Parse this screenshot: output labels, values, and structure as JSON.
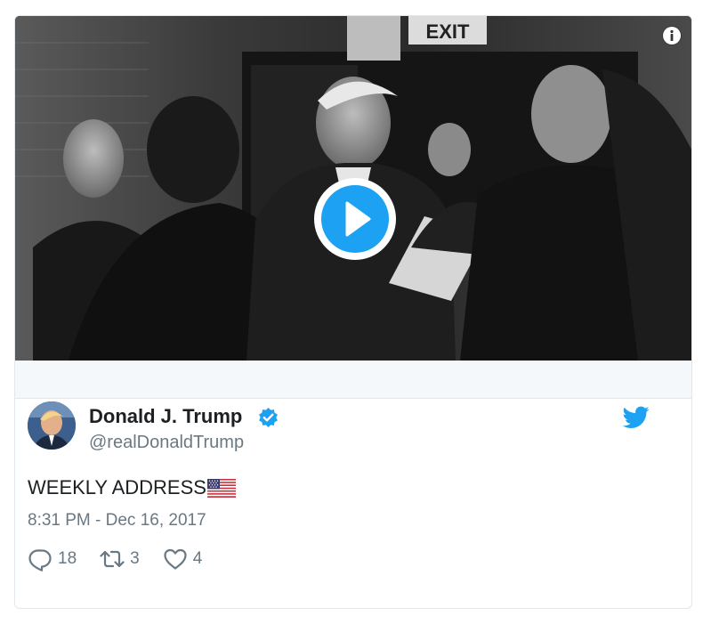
{
  "media": {
    "type": "video",
    "sign_text": "EXIT",
    "play_icon": "play-icon",
    "info_icon": "info-icon"
  },
  "author": {
    "name": "Donald J. Trump",
    "handle": "@realDonaldTrump",
    "verified": true,
    "avatar_icon": "avatar"
  },
  "tweet": {
    "text": "WEEKLY ADDRESS",
    "emoji": "us-flag-icon",
    "timestamp": "8:31 PM - Dec 16, 2017"
  },
  "actions": {
    "replies": "18",
    "retweets": "3",
    "likes": "4"
  },
  "colors": {
    "accent": "#1da1f2",
    "text": "#1c2022",
    "muted": "#697882",
    "border": "#e1e8ed",
    "strip": "#f5f8fa"
  }
}
